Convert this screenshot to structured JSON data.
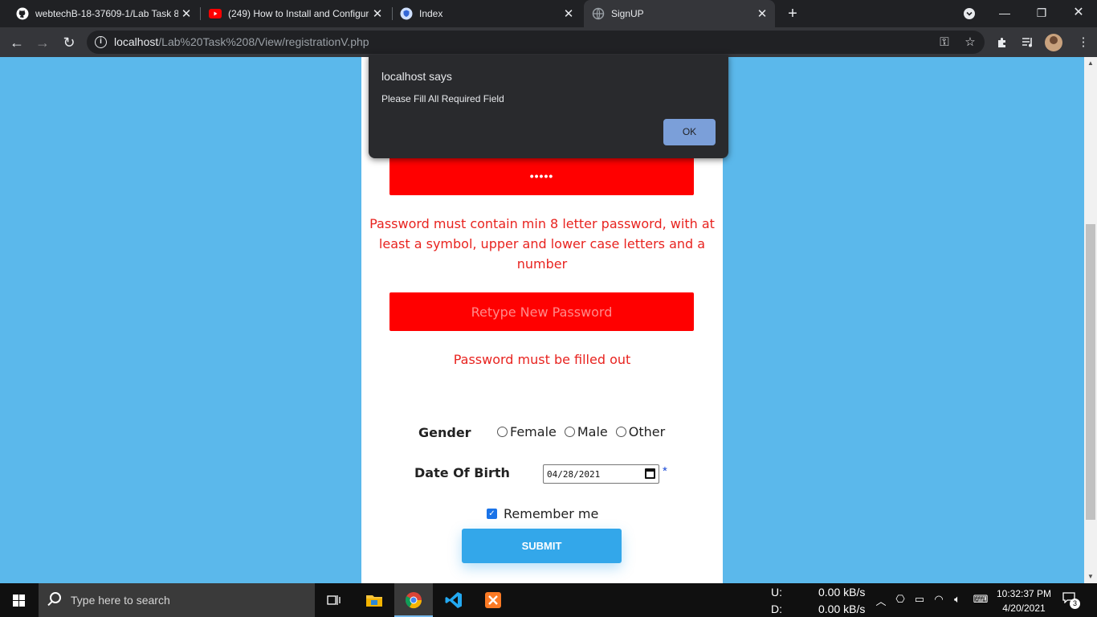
{
  "browser": {
    "tabs": [
      {
        "title": "webtechB-18-37609-1/Lab Task 8"
      },
      {
        "title": "(249) How to Install and Configure"
      },
      {
        "title": "Index"
      },
      {
        "title": "SignUP"
      }
    ],
    "address": {
      "host": "localhost",
      "path": "/Lab%20Task%208/View/registrationV.php"
    }
  },
  "dialog": {
    "title": "localhost says",
    "message": "Please Fill All Required Field",
    "ok_label": "OK"
  },
  "form": {
    "password_value": "•••••",
    "password_error": "Password must contain min 8 letter password, with at least a symbol, upper and lower case letters and a number",
    "retype_placeholder": "Retype New Password",
    "retype_error": "Password must be filled out",
    "gender_label": "Gender",
    "gender_options": [
      "Female",
      "Male",
      "Other"
    ],
    "dob_label": "Date Of Birth",
    "dob_value": "04/28/2021",
    "required_mark": "*",
    "remember_label": "Remember me",
    "remember_checked": true,
    "submit_label": "SUBMIT"
  },
  "taskbar": {
    "search_placeholder": "Type here to search",
    "net_up_label": "U:",
    "net_down_label": "D:",
    "net_up_value": "0.00 kB/s",
    "net_down_value": "0.00 kB/s",
    "time": "10:32:37 PM",
    "date": "4/20/2021",
    "notification_count": "3"
  }
}
